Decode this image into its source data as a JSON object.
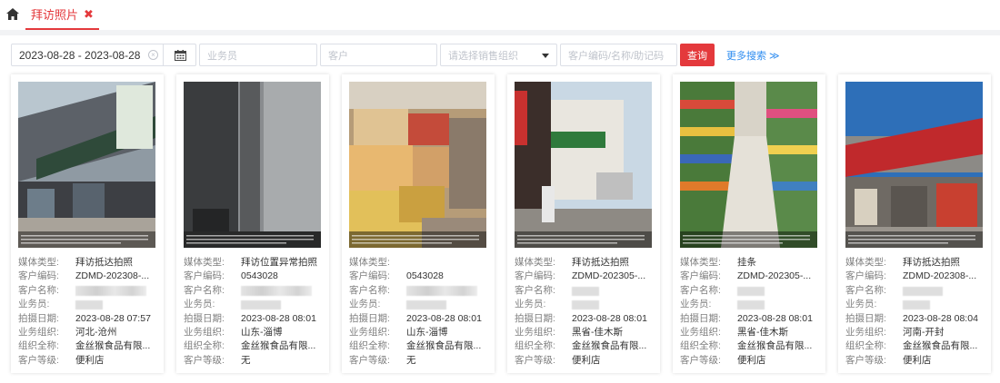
{
  "tabs": {
    "active_label": "拜访照片",
    "close_symbol": "✖"
  },
  "filters": {
    "date_range": "2023-08-28 - 2023-08-28",
    "salesman_placeholder": "业务员",
    "customer_placeholder": "客户",
    "sales_org_placeholder": "请选择销售组织",
    "code_placeholder": "客户编码/名称/助记码",
    "query_label": "查询",
    "more_search_label": "更多搜索 ≫"
  },
  "field_labels": {
    "media_type": "媒体类型:",
    "customer_code": "客户编码:",
    "customer_name": "客户名称:",
    "salesman": "业务员:",
    "shoot_date": "拍摄日期:",
    "business_org": "业务组织:",
    "org_full_name": "组织全称:",
    "customer_level": "客户等级:"
  },
  "cards": [
    {
      "media_type": "拜访抵达拍照",
      "customer_code": "ZDMD-202308-...",
      "shoot_date": "2023-08-28 07:57",
      "business_org": "河北-沧州",
      "org_full_name": "金丝猴食品有限...",
      "customer_level": "便利店"
    },
    {
      "media_type": "拜访位置异常拍照",
      "customer_code": "0543028",
      "shoot_date": "2023-08-28 08:01",
      "business_org": "山东-淄博",
      "org_full_name": "金丝猴食品有限...",
      "customer_level": "无"
    },
    {
      "media_type": "",
      "customer_code": "0543028",
      "shoot_date": "2023-08-28 08:01",
      "business_org": "山东-淄博",
      "org_full_name": "金丝猴食品有限...",
      "customer_level": "无"
    },
    {
      "media_type": "拜访抵达拍照",
      "customer_code": "ZDMD-202305-...",
      "shoot_date": "2023-08-28 08:01",
      "business_org": "黑省-佳木斯",
      "org_full_name": "金丝猴食品有限...",
      "customer_level": "便利店"
    },
    {
      "media_type": "挂条",
      "customer_code": "ZDMD-202305-...",
      "shoot_date": "2023-08-28 08:01",
      "business_org": "黑省-佳木斯",
      "org_full_name": "金丝猴食品有限...",
      "customer_level": "便利店"
    },
    {
      "media_type": "拜访抵达拍照",
      "customer_code": "ZDMD-202308-...",
      "shoot_date": "2023-08-28 08:04",
      "business_org": "河南-开封",
      "org_full_name": "金丝猴食品有限...",
      "customer_level": "便利店"
    }
  ],
  "colors": {
    "accent": "#e4393c",
    "link": "#2d8cf0"
  }
}
